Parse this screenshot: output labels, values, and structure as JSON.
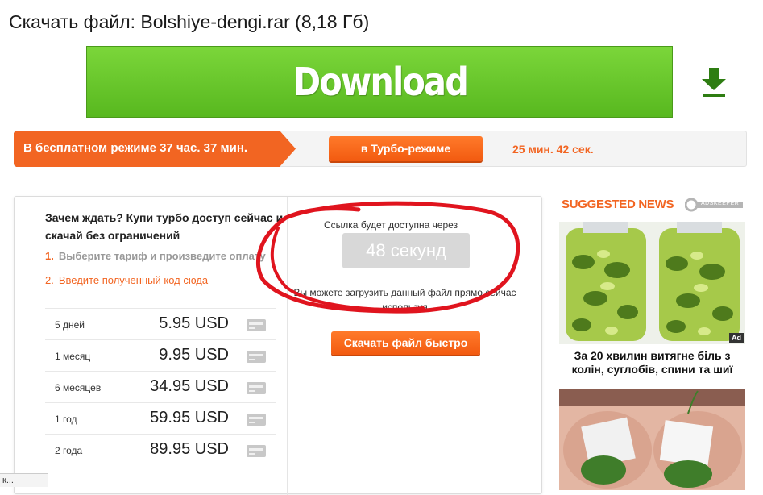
{
  "page": {
    "title": "Скачать файл: Bolshiye-dengi.rar (8,18 Гб)"
  },
  "download_banner": {
    "label": "Download",
    "icon": "download-arrow-icon",
    "colors": {
      "background": "#6cc82c",
      "text": "#ffffff",
      "icon": "#2e7d12"
    }
  },
  "mode_bar": {
    "free_label": "В бесплатном режиме 37 час. 37 мин.",
    "turbo_button": "в Турбо-режиме",
    "turbo_time": "25 мин. 42 сек.",
    "colors": {
      "accent": "#f26522"
    }
  },
  "purchase": {
    "heading": "Зачем ждать? Купи турбо доступ сейчас и скачай без ограничений",
    "steps": [
      {
        "num": "1.",
        "text": "Выберите тариф и произведите оплату"
      },
      {
        "num": "2.",
        "text": "Введите полученный код сюда"
      }
    ],
    "plans": [
      {
        "duration": "5 дней",
        "price": "5.95 USD",
        "icon": "credit-card-icon"
      },
      {
        "duration": "1 месяц",
        "price": "9.95 USD",
        "icon": "credit-card-icon"
      },
      {
        "duration": "6 месяцев",
        "price": "34.95 USD",
        "icon": "credit-card-icon"
      },
      {
        "duration": "1 год",
        "price": "59.95 USD",
        "icon": "credit-card-icon"
      },
      {
        "duration": "2 года",
        "price": "89.95 USD",
        "icon": "credit-card-icon"
      }
    ]
  },
  "countdown": {
    "label": "Ссылка будет доступна через",
    "value": "48 секунд",
    "direct_text": "Вы можете загрузить данный файл прямо сейчас используя",
    "fast_button": "Скачать файл быстро",
    "annotation_color": "#e0141e"
  },
  "suggested_news": {
    "heading": "SUGGESTED NEWS",
    "provider": "ADSKEEPER",
    "items": [
      {
        "title": "За 20 хвилин витягне біль з колін, суглобів, спини та шиї",
        "badge": "Ad"
      },
      {
        "title": ""
      }
    ]
  },
  "status_bar": {
    "text": "к..."
  }
}
